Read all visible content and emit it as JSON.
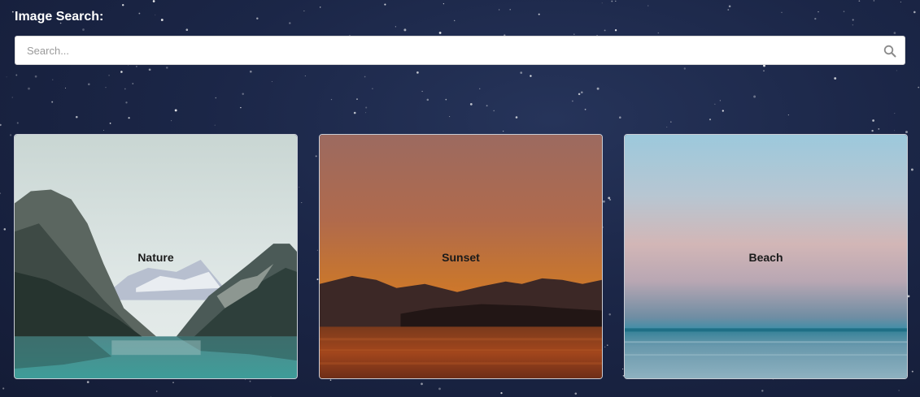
{
  "search": {
    "title": "Image Search:",
    "placeholder": "Search...",
    "value": ""
  },
  "icons": {
    "search": "search-icon"
  },
  "cards": [
    {
      "label": "Nature"
    },
    {
      "label": "Sunset"
    },
    {
      "label": "Beach"
    }
  ]
}
